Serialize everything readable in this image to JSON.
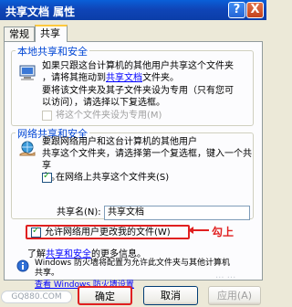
{
  "window": {
    "title": "共享文档 属性",
    "help_btn": "?",
    "close_btn": "X"
  },
  "tabs": [
    {
      "label": "常规"
    },
    {
      "label": "共享"
    }
  ],
  "local_section": {
    "title": "本地共享和安全",
    "para1_line1": "如果只跟这台计算机的其他用户共享这个文件夹",
    "para1_line2": "，请将其拖动到",
    "para1_link": "共享文档",
    "para1_line2_end": "文件夹。",
    "para2_line1": "要将该文件夹及其子文件夹设为专用（只有您可",
    "para2_line2": "以访问），请选择以下复选框。",
    "private_checkbox_label": "将这个文件夹设为专用(M)"
  },
  "network_section": {
    "title": "网络共享和安全",
    "para_line1": "要跟网络用户和这台计算机的其他用户",
    "para_line2": "共享这个文件夹，请选择第一个复选框，键入一个共享",
    "para_line3": "名。",
    "share_checkbox_label": "在网络上共享这个文件夹(S)",
    "share_name_label": "共享名(N):",
    "share_name_value": "共享文档",
    "allow_change_label": "允许网络用户更改我的文件(W)",
    "learn_more_prefix": "了解",
    "learn_more_link": "共享和安全",
    "learn_more_suffix": "的更多信息。"
  },
  "firewall": {
    "line1": "Windows 防火墙将配置为允许此文件夹与其他计算机",
    "line2": "共享。",
    "link": "查看 Windows 防火墙设置"
  },
  "annotation": {
    "text": "勾上",
    "color": "#e02020"
  },
  "buttons": {
    "ok": "确定",
    "cancel": "取消",
    "apply": "应用(A)"
  },
  "watermark": {
    "left": "GQ880.COM",
    "right": "... ..."
  },
  "colors": {
    "title_bar": "#0b3ea8",
    "section_title": "#0046d5",
    "highlight": "#e02020"
  }
}
